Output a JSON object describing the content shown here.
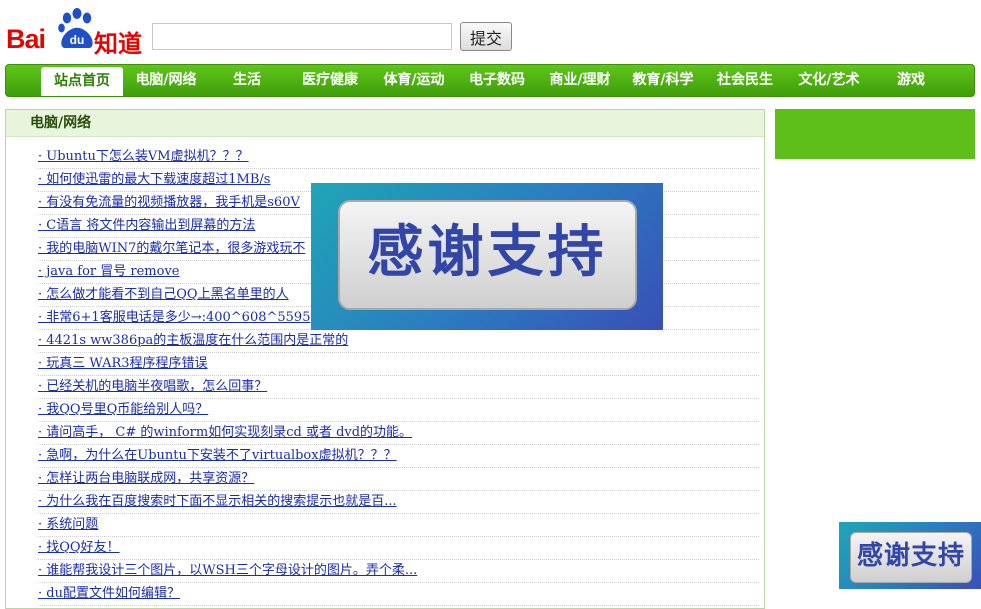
{
  "logo": {
    "bai": "Bai",
    "du": "du",
    "zhidao": "知道"
  },
  "search": {
    "value": "",
    "placeholder": "",
    "submit_label": "提交"
  },
  "nav": {
    "items": [
      {
        "label": "站点首页",
        "active": true
      },
      {
        "label": "电脑/网络"
      },
      {
        "label": "生活"
      },
      {
        "label": "医疗健康"
      },
      {
        "label": "体育/运动"
      },
      {
        "label": "电子数码"
      },
      {
        "label": "商业/理财"
      },
      {
        "label": "教育/科学"
      },
      {
        "label": "社会民生"
      },
      {
        "label": "文化/艺术"
      },
      {
        "label": "游戏"
      }
    ]
  },
  "panel": {
    "title": "电脑/网络",
    "questions": [
      "· Ubuntu下怎么装VM虚拟机？？？",
      "· 如何使迅雷的最大下载速度超过1MB/s",
      "· 有没有免流量的视频播放器，我手机是s60V",
      "· C语言 将文件内容输出到屏幕的方法",
      "· 我的电脑WIN7的戴尔笔记本，很多游戏玩不",
      "· java for 冒号  remove",
      "· 怎么做才能看不到自己QQ上黑名单里的人",
      "· 非常6+1客服电话是多少→:400^608^5595",
      "· 4421s ww386pa的主板温度在什么范围内是正常的",
      "· 玩真三  WAR3程序程序错误",
      "· 已经关机的电脑半夜唱歌，怎么回事？",
      "· 我QQ号里Q币能给别人吗？",
      "· 请问高手，  C# 的winform如何实现刻录cd 或者  dvd的功能。",
      "· 急啊，为什么在Ubuntu下安装不了virtualbox虚拟机？？？",
      "· 怎样让两台电脑联成网，共享资源？",
      "· 为什么我在百度搜索时下面不显示相关的搜索提示也就是百...",
      "· 系统问题",
      "· 找QQ好友！",
      "· 谁能帮我设计三个图片，以WSH三个字母设计的图片。弄个柔...",
      "· du配置文件如何编辑？"
    ]
  },
  "overlay": {
    "thanks_big": "感谢支持",
    "thanks_small": "感谢支持"
  },
  "colors": {
    "brand_red": "#e10602",
    "nav_green": "#4fb012",
    "link_blue": "#1a2dab",
    "badge_blue": "#3146a6"
  }
}
